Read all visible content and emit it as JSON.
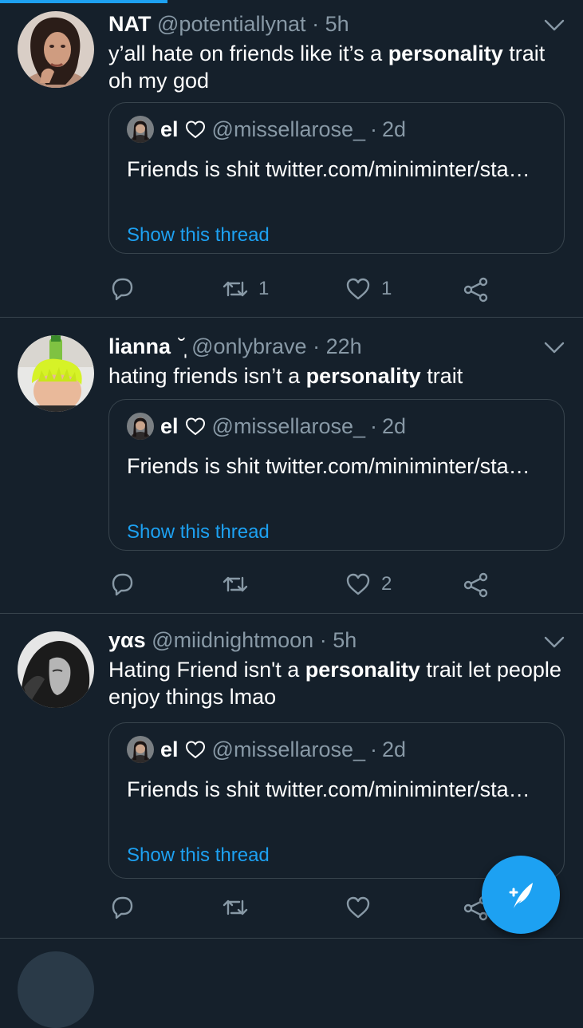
{
  "tweets": [
    {
      "name": "NAT",
      "handle": "@potentiallynat",
      "sep": "·",
      "time": "5h",
      "text_before": "y’all hate on friends like it’s a ",
      "text_bold": "personality",
      "text_after": " trait oh my god",
      "quote": {
        "name": "el",
        "handle": "@missellarose_",
        "sep": "·",
        "time": "2d",
        "text": "Friends is shit twitter.com/miniminter/sta…",
        "link": "Show this thread"
      },
      "retweets": "1",
      "likes": "1"
    },
    {
      "name": "lianna",
      "name_emoji": "˘̩̩̩",
      "handle": "@onlybrave",
      "sep": "·",
      "time": "22h",
      "text_before": "hating friends isn’t a ",
      "text_bold": "personality",
      "text_after": " trait",
      "quote": {
        "name": "el",
        "handle": "@missellarose_",
        "sep": "·",
        "time": "2d",
        "text": "Friends is shit twitter.com/miniminter/sta…",
        "link": "Show this thread"
      },
      "retweets": "",
      "likes": "2"
    },
    {
      "name": "yαs",
      "handle": "@miidnightmoon",
      "sep": "·",
      "time": "5h",
      "text_before": "Hating Friend isn't a ",
      "text_bold": "personality",
      "text_after": " trait let people enjoy things lmao",
      "quote": {
        "name": "el",
        "handle": "@missellarose_",
        "sep": "·",
        "time": "2d",
        "text": "Friends is shit twitter.com/miniminter/sta…",
        "link": "Show this thread"
      },
      "retweets": "",
      "likes": ""
    }
  ],
  "colors": {
    "background": "#15202b",
    "accent": "#1da1f2",
    "muted": "#8899a6",
    "border": "#38444d"
  },
  "icons": [
    "reply-icon",
    "retweet-icon",
    "like-icon",
    "share-icon",
    "chevron-down-icon",
    "heart-outline-icon",
    "compose-tweet-icon"
  ]
}
